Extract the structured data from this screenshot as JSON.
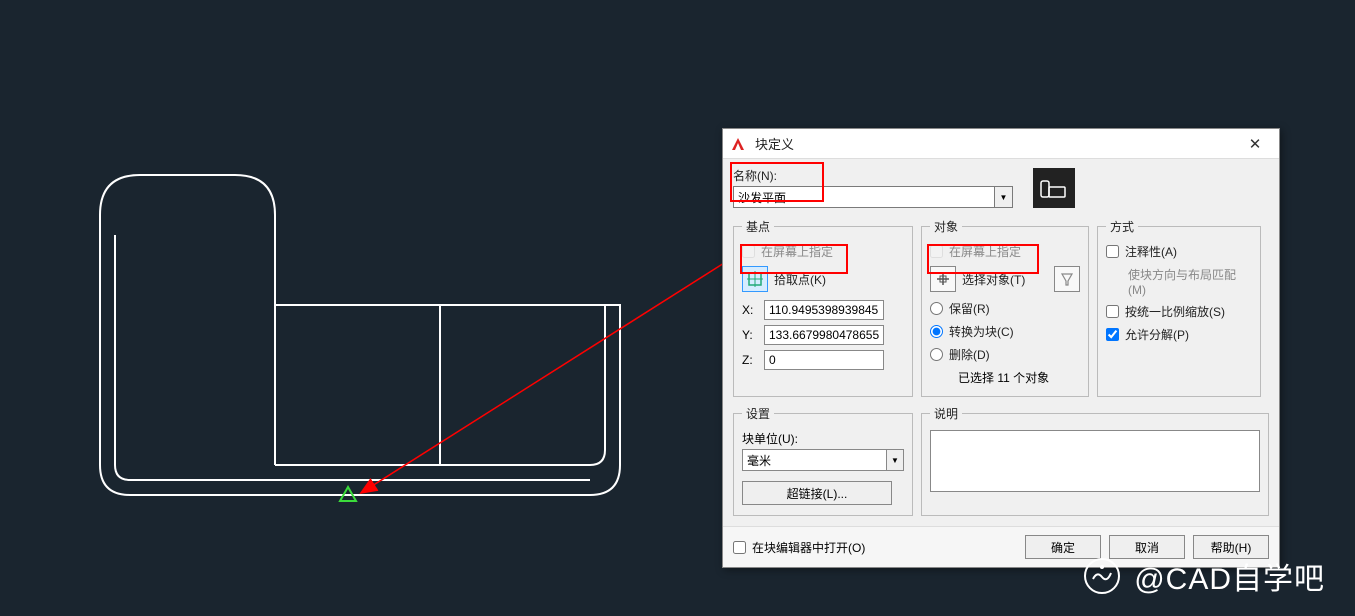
{
  "dialog": {
    "title": "块定义",
    "name_label": "名称(N):",
    "name_value": "沙发平面",
    "basepoint": {
      "legend": "基点",
      "onscreen": "在屏幕上指定",
      "pick_label": "拾取点(K)",
      "x_label": "X:",
      "x_value": "110.9495398939845",
      "y_label": "Y:",
      "y_value": "133.6679980478655",
      "z_label": "Z:",
      "z_value": "0"
    },
    "objects": {
      "legend": "对象",
      "onscreen": "在屏幕上指定",
      "select_label": "选择对象(T)",
      "retain": "保留(R)",
      "convert": "转换为块(C)",
      "delete": "删除(D)",
      "selected_info": "已选择 11 个对象"
    },
    "mode": {
      "legend": "方式",
      "annot": "注释性(A)",
      "match": "使块方向与布局匹配(M)",
      "uniform": "按统一比例缩放(S)",
      "explode": "允许分解(P)"
    },
    "settings": {
      "legend": "设置",
      "unit_label": "块单位(U):",
      "unit_value": "毫米",
      "hyperlink": "超链接(L)..."
    },
    "desc": {
      "legend": "说明"
    },
    "footer": {
      "open_editor": "在块编辑器中打开(O)",
      "ok": "确定",
      "cancel": "取消",
      "help": "帮助(H)"
    }
  },
  "watermark": {
    "text": "@CAD自学吧"
  }
}
